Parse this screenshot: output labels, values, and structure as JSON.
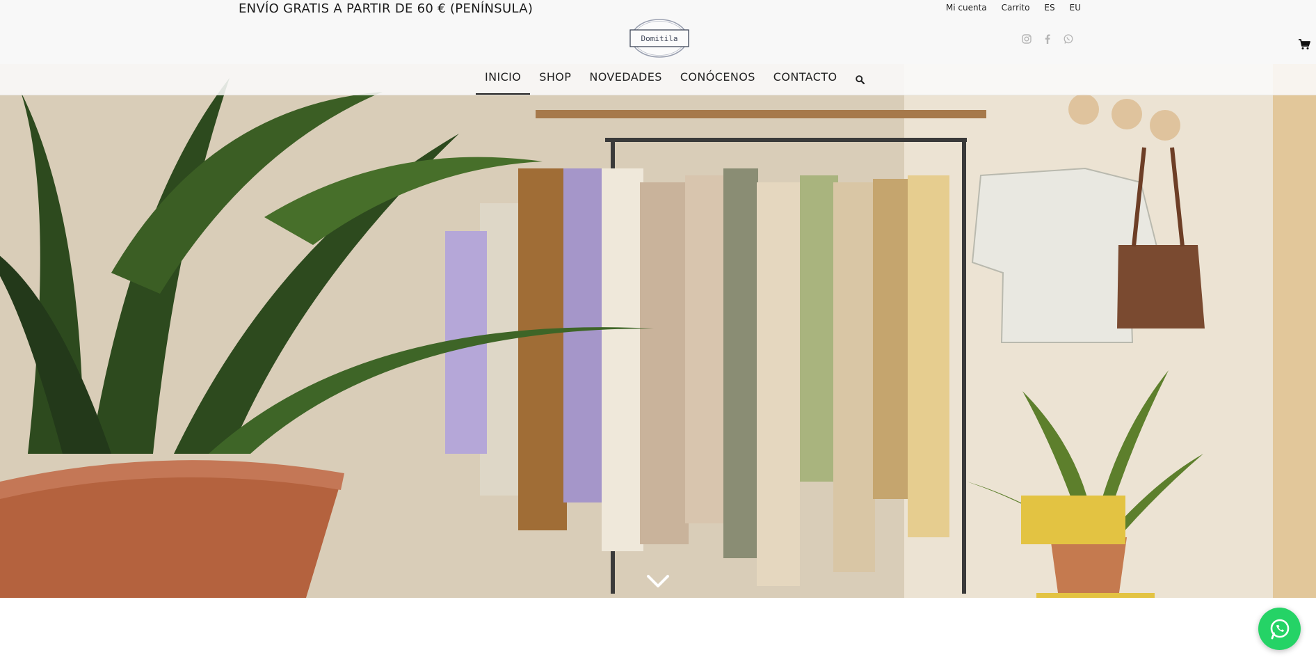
{
  "header": {
    "promo": "ENVÍO GRATIS A PARTIR DE 60 € (PENÍNSULA)",
    "links": [
      "Mi cuenta",
      "Carrito",
      "ES",
      "EU"
    ],
    "logo_text": "Domitila",
    "social_icons": [
      "instagram-icon",
      "facebook-icon",
      "whatsapp-icon"
    ],
    "cart_icon": "cart-icon"
  },
  "nav": {
    "items": [
      "INICIO",
      "SHOP",
      "NOVEDADES",
      "CONÓCENOS",
      "CONTACTO"
    ],
    "active": "INICIO",
    "search_icon": "search-icon"
  },
  "hero": {
    "scroll_icon": "chevron-down-icon"
  },
  "floating": {
    "whatsapp_icon": "whatsapp-icon",
    "whatsapp_color": "#25d366"
  }
}
